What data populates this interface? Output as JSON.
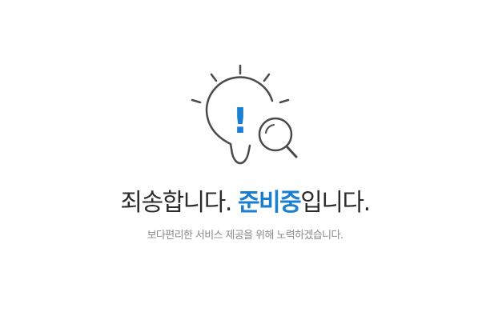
{
  "colors": {
    "accent": "#1a7fd0",
    "icon_stroke": "#4a4a4a",
    "headline_text": "#2b2b2b",
    "subtext": "#8a8a8a",
    "background": "#ffffff"
  },
  "illustration": {
    "icon": "lightbulb-with-magnifier-icon",
    "mark": "!"
  },
  "headline": {
    "part1": "죄송합니다. ",
    "highlight": "준비중",
    "part2": "입니다."
  },
  "subtext": "보다편리한 서비스 제공을 위해 노력하겠습니다."
}
